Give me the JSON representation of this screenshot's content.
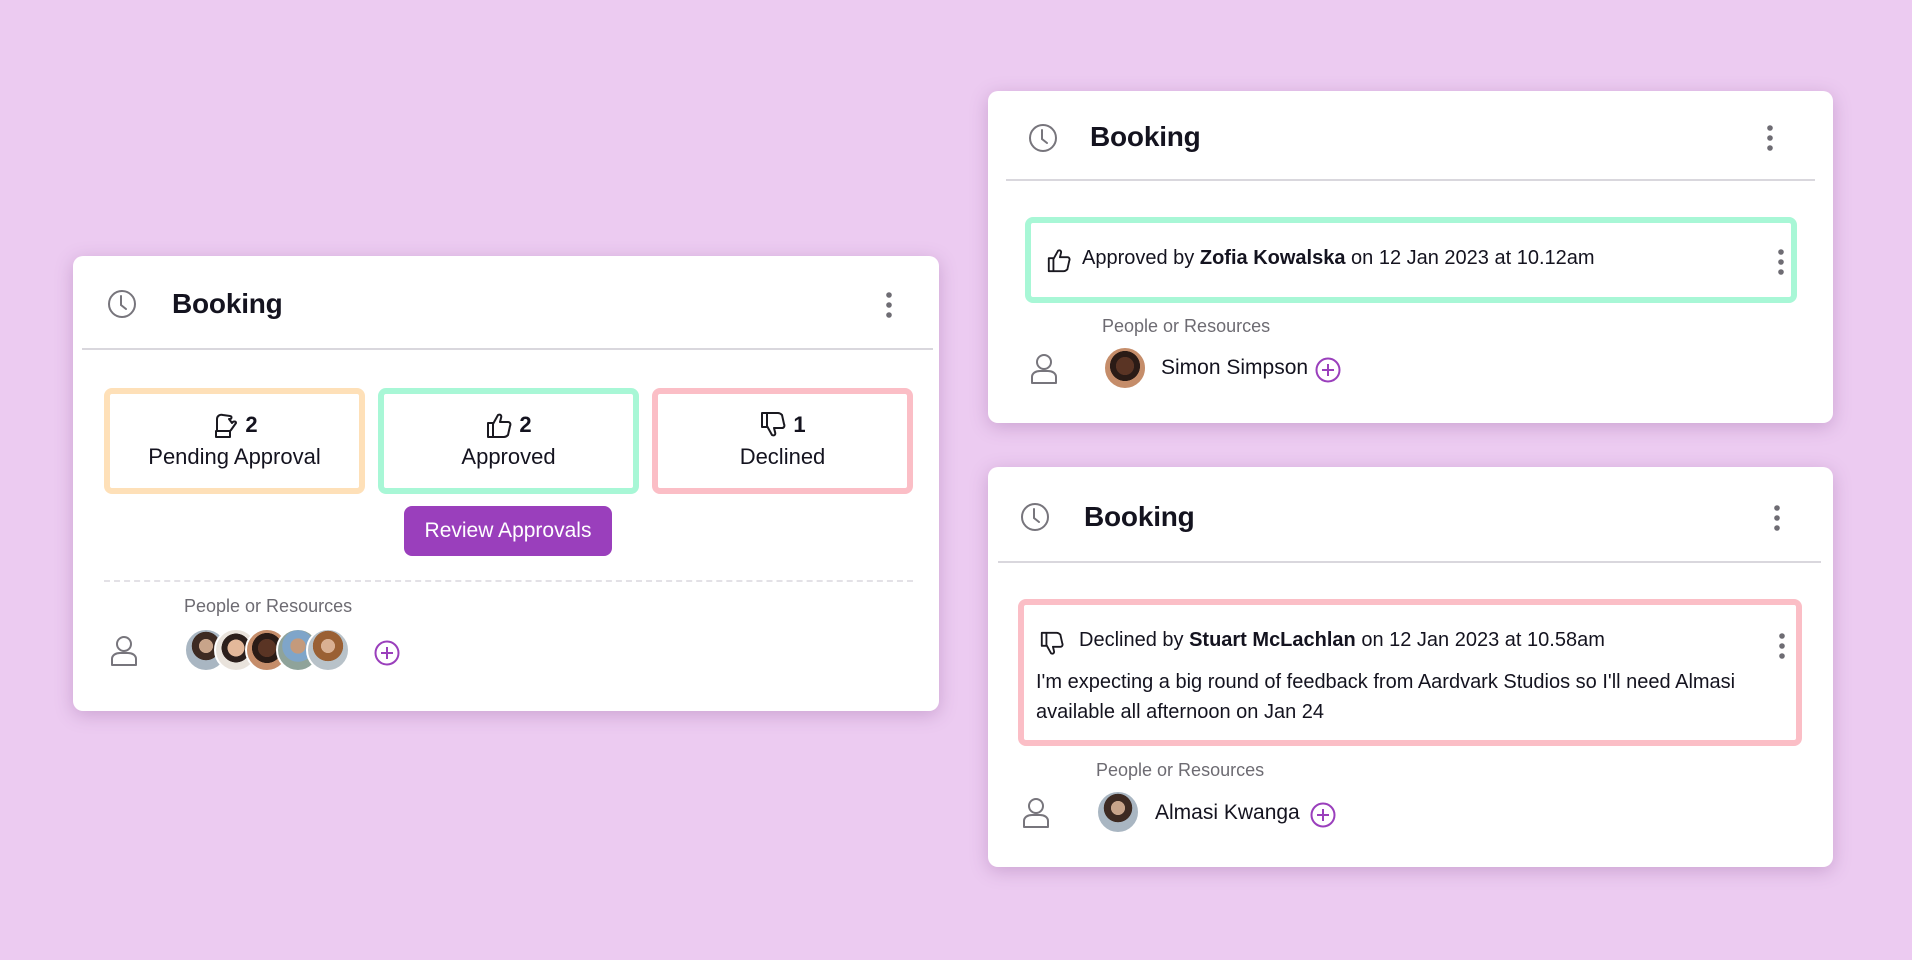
{
  "colors": {
    "background": "#eccbf1",
    "pending": "#fee0b8",
    "approved": "#a8f7d6",
    "declined": "#fbbec6",
    "accent": "#9a3fbc"
  },
  "summary_card": {
    "title": "Booking",
    "icon": "clock-icon",
    "stats": [
      {
        "icon": "hand-raised-icon",
        "count": "2",
        "label": "Pending Approval"
      },
      {
        "icon": "thumbs-up-icon",
        "count": "2",
        "label": "Approved"
      },
      {
        "icon": "thumbs-down-icon",
        "count": "1",
        "label": "Declined"
      }
    ],
    "review_button": "Review Approvals",
    "people_label": "People or Resources",
    "avatars_count": 5
  },
  "approved_card": {
    "title": "Booking",
    "status": {
      "prefix": "Approved by ",
      "name": "Zofia Kowalska",
      "suffix": " on 12 Jan 2023 at 10.12am"
    },
    "people_label": "People or Resources",
    "person": "Simon Simpson"
  },
  "declined_card": {
    "title": "Booking",
    "status": {
      "prefix": "Declined by ",
      "name": "Stuart McLachlan",
      "suffix": " on 12 Jan 2023 at 10.58am"
    },
    "note": "I'm expecting a big round of feedback from Aardvark Studios so I'll need Almasi available all afternoon on Jan 24",
    "people_label": "People or Resources",
    "person": "Almasi Kwanga"
  }
}
